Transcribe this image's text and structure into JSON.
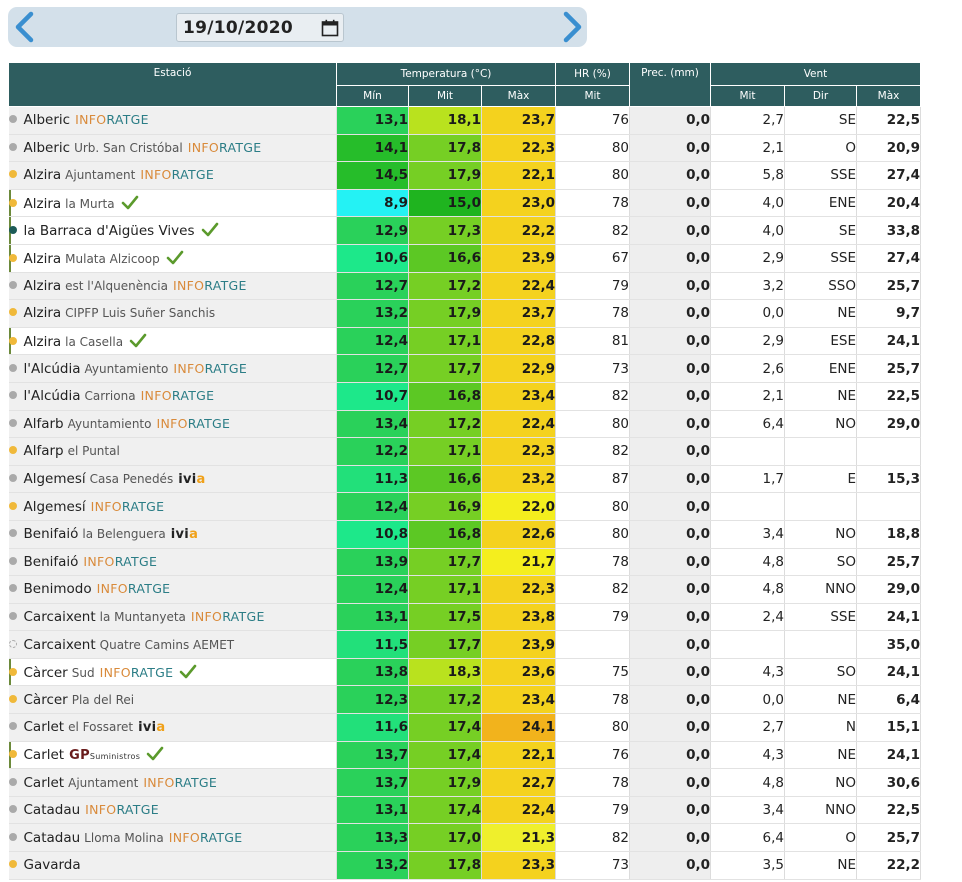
{
  "date": "19/10/2020",
  "headers": {
    "station": "Estació",
    "temperature": "Temperatura (°C)",
    "hr": "HR (%)",
    "prec": "Prec. (mm)",
    "wind": "Vent",
    "tmin": "Mín",
    "tmit": "Mit",
    "tmax": "Màx",
    "hrmit": "Mit",
    "wmit": "Mit",
    "wdir": "Dir",
    "wmax": "Màx"
  },
  "colors": {
    "header": "#2e5d5f",
    "dot_grey": "#aaaaaa",
    "dot_yellow": "#f0b93a",
    "dot_teal": "#1d5b57",
    "check": "#5b9a2c",
    "inforatge_orange": "#d98a3a",
    "inforatge_teal": "#2b7d86"
  },
  "rows": [
    {
      "name": "Alberic",
      "sub": "",
      "brand": "inforatge",
      "check": false,
      "dot": "grey",
      "hl": false,
      "tmin": "13,1",
      "tmit": "18,1",
      "tmax": "23,7",
      "hr": "76",
      "prec": "0,0",
      "wmit": "2,7",
      "wdir": "SE",
      "wmax": "22,5"
    },
    {
      "name": "Alberic",
      "sub": "Urb. San Cristóbal",
      "brand": "inforatge",
      "check": false,
      "dot": "grey",
      "hl": false,
      "tmin": "14,1",
      "tmit": "17,8",
      "tmax": "22,3",
      "hr": "80",
      "prec": "0,0",
      "wmit": "2,1",
      "wdir": "O",
      "wmax": "20,9"
    },
    {
      "name": "Alzira",
      "sub": "Ajuntament",
      "brand": "inforatge",
      "check": false,
      "dot": "yellow",
      "hl": false,
      "tmin": "14,5",
      "tmit": "17,9",
      "tmax": "22,1",
      "hr": "80",
      "prec": "0,0",
      "wmit": "5,8",
      "wdir": "SSE",
      "wmax": "27,4"
    },
    {
      "name": "Alzira",
      "sub": "la Murta",
      "brand": "",
      "check": true,
      "dot": "yellow",
      "hl": true,
      "tmin": "8,9",
      "tmit": "15,0",
      "tmax": "23,0",
      "hr": "78",
      "prec": "0,0",
      "wmit": "4,0",
      "wdir": "ENE",
      "wmax": "20,4"
    },
    {
      "name": "la Barraca d'Aigües Vives",
      "sub": "",
      "brand": "",
      "check": true,
      "dot": "teal",
      "hl": true,
      "tmin": "12,9",
      "tmit": "17,3",
      "tmax": "22,2",
      "hr": "82",
      "prec": "0,0",
      "wmit": "4,0",
      "wdir": "SE",
      "wmax": "33,8"
    },
    {
      "name": "Alzira",
      "sub": "Mulata Alzicoop",
      "brand": "",
      "check": true,
      "dot": "yellow",
      "hl": true,
      "tmin": "10,6",
      "tmit": "16,6",
      "tmax": "23,9",
      "hr": "67",
      "prec": "0,0",
      "wmit": "2,9",
      "wdir": "SSE",
      "wmax": "27,4"
    },
    {
      "name": "Alzira",
      "sub": "est l'Alquenència",
      "brand": "inforatge",
      "check": false,
      "dot": "grey",
      "hl": false,
      "tmin": "12,7",
      "tmit": "17,2",
      "tmax": "22,4",
      "hr": "79",
      "prec": "0,0",
      "wmit": "3,2",
      "wdir": "SSO",
      "wmax": "25,7"
    },
    {
      "name": "Alzira",
      "sub": "CIPFP Luis Suñer Sanchis",
      "brand": "",
      "check": false,
      "dot": "yellow",
      "hl": false,
      "tmin": "13,2",
      "tmit": "17,9",
      "tmax": "23,7",
      "hr": "78",
      "prec": "0,0",
      "wmit": "0,0",
      "wdir": "NE",
      "wmax": "9,7"
    },
    {
      "name": "Alzira",
      "sub": "la Casella",
      "brand": "",
      "check": true,
      "dot": "yellow",
      "hl": true,
      "tmin": "12,4",
      "tmit": "17,1",
      "tmax": "22,8",
      "hr": "81",
      "prec": "0,0",
      "wmit": "2,9",
      "wdir": "ESE",
      "wmax": "24,1"
    },
    {
      "name": "l'Alcúdia",
      "sub": "Ayuntamiento",
      "brand": "inforatge",
      "check": false,
      "dot": "grey",
      "hl": false,
      "tmin": "12,7",
      "tmit": "17,7",
      "tmax": "22,9",
      "hr": "73",
      "prec": "0,0",
      "wmit": "2,6",
      "wdir": "ENE",
      "wmax": "25,7"
    },
    {
      "name": "l'Alcúdia",
      "sub": "Carriona",
      "brand": "inforatge",
      "check": false,
      "dot": "grey",
      "hl": false,
      "tmin": "10,7",
      "tmit": "16,8",
      "tmax": "23,4",
      "hr": "82",
      "prec": "0,0",
      "wmit": "2,1",
      "wdir": "NE",
      "wmax": "22,5"
    },
    {
      "name": "Alfarb",
      "sub": "Ayuntamiento",
      "brand": "inforatge",
      "check": false,
      "dot": "grey",
      "hl": false,
      "tmin": "13,4",
      "tmit": "17,2",
      "tmax": "22,4",
      "hr": "80",
      "prec": "0,0",
      "wmit": "6,4",
      "wdir": "NO",
      "wmax": "29,0"
    },
    {
      "name": "Alfarp",
      "sub": "el Puntal",
      "brand": "",
      "check": false,
      "dot": "yellow",
      "hl": false,
      "tmin": "12,2",
      "tmit": "17,1",
      "tmax": "22,3",
      "hr": "82",
      "prec": "0,0",
      "wmit": "",
      "wdir": "",
      "wmax": ""
    },
    {
      "name": "Algemesí",
      "sub": "Casa Penedés",
      "brand": "ivia",
      "check": false,
      "dot": "grey",
      "hl": false,
      "tmin": "11,3",
      "tmit": "16,6",
      "tmax": "23,2",
      "hr": "87",
      "prec": "0,0",
      "wmit": "1,7",
      "wdir": "E",
      "wmax": "15,3"
    },
    {
      "name": "Algemesí",
      "sub": "",
      "brand": "inforatge",
      "check": false,
      "dot": "yellow",
      "hl": false,
      "tmin": "12,4",
      "tmit": "16,9",
      "tmax": "22,0",
      "hr": "80",
      "prec": "0,0",
      "wmit": "",
      "wdir": "",
      "wmax": ""
    },
    {
      "name": "Benifaió",
      "sub": "la Belenguera",
      "brand": "ivia",
      "check": false,
      "dot": "grey",
      "hl": false,
      "tmin": "10,8",
      "tmit": "16,8",
      "tmax": "22,6",
      "hr": "80",
      "prec": "0,0",
      "wmit": "3,4",
      "wdir": "NO",
      "wmax": "18,8"
    },
    {
      "name": "Benifaió",
      "sub": "",
      "brand": "inforatge",
      "check": false,
      "dot": "grey",
      "hl": false,
      "tmin": "13,9",
      "tmit": "17,7",
      "tmax": "21,7",
      "hr": "78",
      "prec": "0,0",
      "wmit": "4,8",
      "wdir": "SO",
      "wmax": "25,7"
    },
    {
      "name": "Benimodo",
      "sub": "",
      "brand": "inforatge",
      "check": false,
      "dot": "grey",
      "hl": false,
      "tmin": "12,4",
      "tmit": "17,1",
      "tmax": "22,3",
      "hr": "82",
      "prec": "0,0",
      "wmit": "4,8",
      "wdir": "NNO",
      "wmax": "29,0"
    },
    {
      "name": "Carcaixent",
      "sub": "la Muntanyeta",
      "brand": "inforatge",
      "check": false,
      "dot": "grey",
      "hl": false,
      "tmin": "13,1",
      "tmit": "17,5",
      "tmax": "23,8",
      "hr": "79",
      "prec": "0,0",
      "wmit": "2,4",
      "wdir": "SSE",
      "wmax": "24,1"
    },
    {
      "name": "Carcaixent",
      "sub": "Quatre Camins AEMET",
      "brand": "",
      "check": false,
      "dot": "dashed",
      "hl": false,
      "tmin": "11,5",
      "tmit": "17,7",
      "tmax": "23,9",
      "hr": "",
      "prec": "0,0",
      "wmit": "",
      "wdir": "",
      "wmax": "35,0"
    },
    {
      "name": "Càrcer",
      "sub": "Sud",
      "brand": "inforatge",
      "check": true,
      "dot": "yellow",
      "hl": true,
      "tmin": "13,8",
      "tmit": "18,3",
      "tmax": "23,6",
      "hr": "75",
      "prec": "0,0",
      "wmit": "4,3",
      "wdir": "SO",
      "wmax": "24,1"
    },
    {
      "name": "Càrcer",
      "sub": "Pla del Rei",
      "brand": "",
      "check": false,
      "dot": "yellow",
      "hl": false,
      "tmin": "12,3",
      "tmit": "17,2",
      "tmax": "23,4",
      "hr": "78",
      "prec": "0,0",
      "wmit": "0,0",
      "wdir": "NE",
      "wmax": "6,4"
    },
    {
      "name": "Carlet",
      "sub": "el Fossaret",
      "brand": "ivia",
      "check": false,
      "dot": "grey",
      "hl": false,
      "tmin": "11,6",
      "tmit": "17,4",
      "tmax": "24,1",
      "hr": "80",
      "prec": "0,0",
      "wmit": "2,7",
      "wdir": "N",
      "wmax": "15,1"
    },
    {
      "name": "Carlet",
      "sub": "",
      "brand": "gp",
      "check": true,
      "dot": "yellow",
      "hl": true,
      "tmin": "13,7",
      "tmit": "17,4",
      "tmax": "22,1",
      "hr": "76",
      "prec": "0,0",
      "wmit": "4,3",
      "wdir": "NE",
      "wmax": "24,1"
    },
    {
      "name": "Carlet",
      "sub": "Ajuntament",
      "brand": "inforatge",
      "check": false,
      "dot": "grey",
      "hl": false,
      "tmin": "13,7",
      "tmit": "17,9",
      "tmax": "22,7",
      "hr": "78",
      "prec": "0,0",
      "wmit": "4,8",
      "wdir": "NO",
      "wmax": "30,6"
    },
    {
      "name": "Catadau",
      "sub": "",
      "brand": "inforatge",
      "check": false,
      "dot": "grey",
      "hl": false,
      "tmin": "13,1",
      "tmit": "17,4",
      "tmax": "22,4",
      "hr": "79",
      "prec": "0,0",
      "wmit": "3,4",
      "wdir": "NNO",
      "wmax": "22,5"
    },
    {
      "name": "Catadau",
      "sub": "Lloma Molina",
      "brand": "inforatge",
      "check": false,
      "dot": "grey",
      "hl": false,
      "tmin": "13,3",
      "tmit": "17,0",
      "tmax": "21,3",
      "hr": "82",
      "prec": "0,0",
      "wmit": "6,4",
      "wdir": "O",
      "wmax": "25,7"
    },
    {
      "name": "Gavarda",
      "sub": "",
      "brand": "",
      "check": false,
      "dot": "yellow",
      "hl": false,
      "tmin": "13,2",
      "tmit": "17,8",
      "tmax": "23,3",
      "hr": "73",
      "prec": "0,0",
      "wmit": "3,5",
      "wdir": "NE",
      "wmax": "22,2"
    }
  ],
  "brands": {
    "inforatge_a": "INFO",
    "inforatge_b": "RATGE",
    "ivia_a": "ivi",
    "ivia_b": "a",
    "gp_a": "GP",
    "gp_b": "Suministros"
  }
}
